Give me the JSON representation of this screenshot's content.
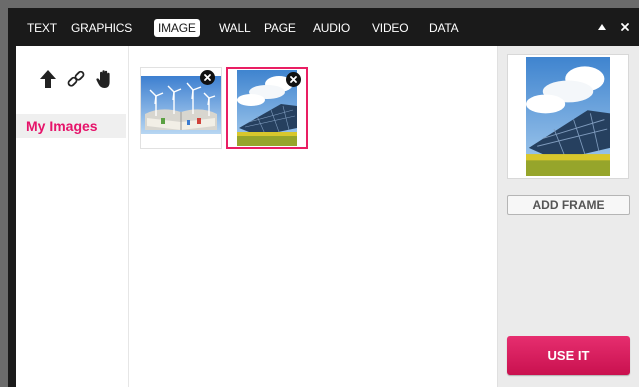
{
  "colors": {
    "accent": "#e6136a",
    "topbar": "#1a1a1a",
    "selected_border": "#e91e63"
  },
  "tabs": [
    {
      "label": "TEXT"
    },
    {
      "label": "GRAPHICS"
    },
    {
      "label": "IMAGE",
      "active": true
    },
    {
      "label": "WALL"
    },
    {
      "label": "PAGE"
    },
    {
      "label": "AUDIO"
    },
    {
      "label": "VIDEO"
    },
    {
      "label": "DATA"
    }
  ],
  "window_controls": {
    "collapse_icon": "triangle-up-icon",
    "close_icon": "close-icon"
  },
  "sidebar": {
    "tools": [
      "upload-arrow-icon",
      "link-icon",
      "hand-icon"
    ],
    "my_images_label": "My Images"
  },
  "images": [
    {
      "name": "wind-turbines-thumbnail",
      "selected": false
    },
    {
      "name": "solar-panels-thumbnail",
      "selected": true
    }
  ],
  "right_panel": {
    "add_frame_label": "ADD FRAME",
    "use_it_label": "USE IT"
  }
}
